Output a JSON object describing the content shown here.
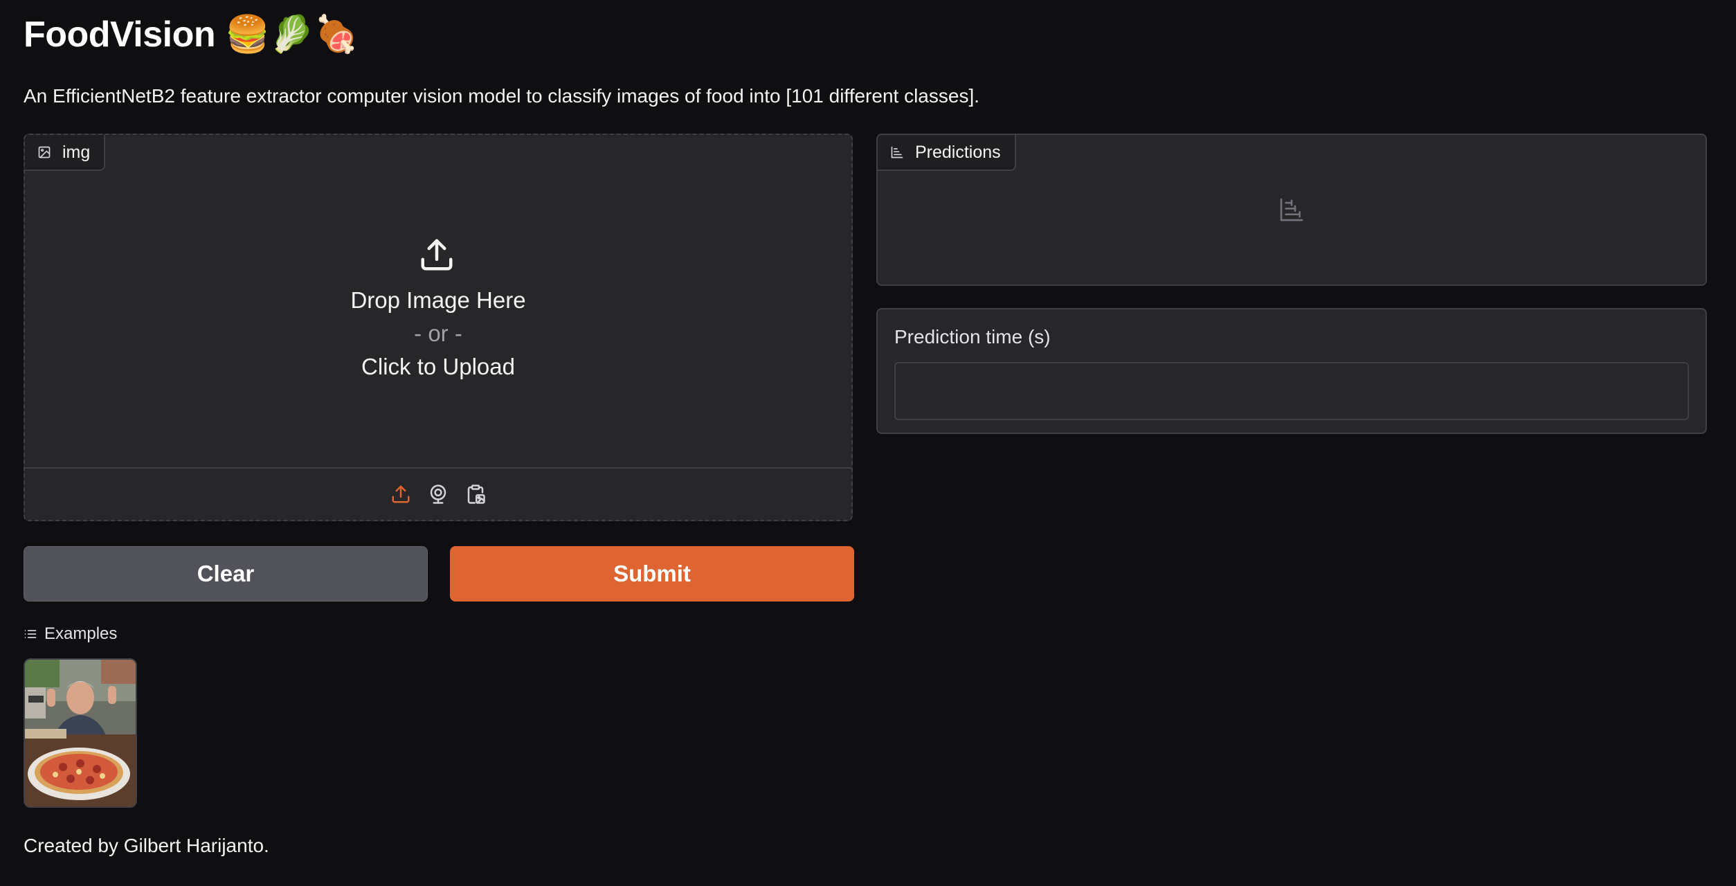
{
  "header": {
    "title": "FoodVision 🍔🥬🍖",
    "description": "An EfficientNetB2 feature extractor computer vision model to classify images of food into [101 different classes]."
  },
  "image_input": {
    "label": "img",
    "label_icon": "image-icon",
    "upload_icon": "upload-icon",
    "drop_text": "Drop Image Here",
    "or_text": "- or -",
    "click_text": "Click to Upload",
    "sources": [
      {
        "name": "upload",
        "icon": "upload-icon",
        "active": true
      },
      {
        "name": "webcam",
        "icon": "webcam-icon",
        "active": false
      },
      {
        "name": "clipboard",
        "icon": "clipboard-icon",
        "active": false
      }
    ]
  },
  "buttons": {
    "clear_label": "Clear",
    "submit_label": "Submit"
  },
  "examples": {
    "label": "Examples",
    "label_icon": "list-icon",
    "items": [
      {
        "icon": "example-thumbnail-pizza"
      }
    ]
  },
  "footer": {
    "text": "Created by Gilbert Harijanto."
  },
  "predictions": {
    "label": "Predictions",
    "label_icon": "bar-chart-icon",
    "empty_icon": "bar-chart-icon"
  },
  "prediction_time": {
    "label": "Prediction time (s)",
    "value": ""
  },
  "colors": {
    "background": "#0f0f11",
    "panel": "#27272a",
    "border": "#3f3f46",
    "accent": "#de6531",
    "secondary_button": "#52525b"
  }
}
